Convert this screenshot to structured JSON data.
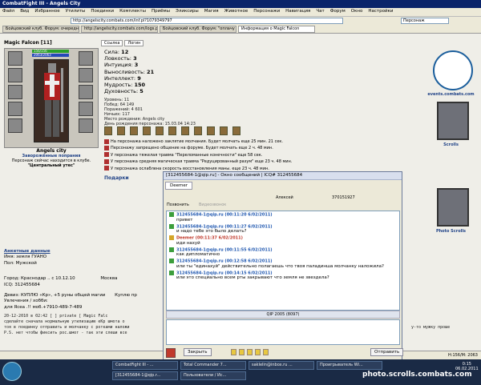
{
  "browser": {
    "title": "CombatFight III - Angels City",
    "menu": [
      "Файл",
      "Вид",
      "Избранное",
      "Утилиты",
      "Поединки",
      "Комплекты",
      "Приёмы",
      "Эликсиры",
      "Магия",
      "Животное",
      "Персонажи",
      "Навигация",
      "Чат",
      "Форум",
      "Окно",
      "Настройки"
    ],
    "address": "http://angelscity.combats.com/inf.pl?1079349797",
    "search_placeholder": "Персонаж",
    "tabs": [
      "Бойцовский клуб. Форум: очередно...",
      "http://angelscity.combats.com/logs.pl...",
      "Бойцовский клуб. Форум: \"оплачу м...",
      "Информация о Magic Falcon"
    ],
    "status": "H:156/M: 2063"
  },
  "character": {
    "name": "Magic Falcon [11]",
    "hp": "156/156",
    "mp": "2063/2063",
    "city": "Angels city",
    "clan": "Заворожённые попрания",
    "location_line1": "Персонаж сейчас находится в клубе.",
    "location_line2": "\"Центральный утес\"",
    "buttons": {
      "links": "Ссылка",
      "login": "Логин"
    },
    "stats": {
      "strength": {
        "label": "Сила:",
        "value": "12"
      },
      "agility": {
        "label": "Ловкость:",
        "value": "3"
      },
      "intuition": {
        "label": "Интуиция:",
        "value": "3"
      },
      "endurance": {
        "label": "Выносливость:",
        "value": "21"
      },
      "intellect": {
        "label": "Интеллект:",
        "value": "9"
      },
      "wisdom": {
        "label": "Мудрость:",
        "value": "150"
      },
      "spirit": {
        "label": "Духовность:",
        "value": "5"
      }
    },
    "small": [
      "Уровень: 11",
      "Побед: 64 149",
      "Поражений: 4 601",
      "Ничьих: 117",
      "Место рождения: Angels city",
      "День рождения персонажа: 15.03.04 14:23"
    ],
    "effects": [
      "На персонажа наложено заклятие молчания. Будет молчать еще 25 мин. 21 сек.",
      "Персонажу запрещено общение на форуме. Будет молчать еще 2 ч. 48 мин.",
      "У персонажа тяжелая травма \"Переломанные конечности\" еще 58 сек.",
      "У персонажа средняя магическая травма \"Редуцированный разум\" еще 23 ч. 48 мин.",
      "У персонажа ослаблена скорость восстановления маны. еще 23 ч. 48 мин."
    ],
    "gifts": "Подарки"
  },
  "right": {
    "site": "events.combats.com",
    "scrolls": "Scrolls",
    "photo": "Photo Scrolls"
  },
  "profile": {
    "header": "Анкетные данные",
    "name": "Имя: земля ГУАНО",
    "sex": "Пол: Мужской",
    "city": "Город: Краснодар .. с 10.12.10",
    "city2": "Москва",
    "icq": "ICQ: 312455684",
    "motto": "Девиз: КУПЛЮ «Кр», +5 руны общей магии",
    "motto2": "Куплю пр",
    "hobby_lbl": "Увлечения / хобби:",
    "hobby": "для Ясеа .!! моб.+7910-489-7-489"
  },
  "diary": [
    "20-12-2010 в 02:42  [      ] private [ Magic Falc",
    "сделайте сначала нормальную утилизацию еКр шмота о",
    "тоя в поединку отправить и молчанку с ротками наложи",
    "P.S. нет чтобы фиксить рос.шмот - так эти слеши все"
  ],
  "diary_right": "у-то мужку проше",
  "qip": {
    "title": "[312455684-1@qip.ru] - Окно сообщений | ICQ# 312455684",
    "contact_tab": "Deemer",
    "call": "Позвонить",
    "video": "Видеозвонок",
    "nick": "Алексей",
    "uin": "370151927",
    "version": "QIP 2005 (8097)",
    "close": "Закрыть",
    "send": "Отправить",
    "messages": [
      {
        "from": "312455684-1@qip.ru (00:11:20 6/02/2011)",
        "text": "привет",
        "own": false
      },
      {
        "from": "312455684-1@qip.ru (00:11:27 6/02/2011)",
        "text": "и надо тебе это было делать?",
        "own": false
      },
      {
        "from": "Deemer (00:11:37 6/02/2011)",
        "text": "иди нахуй",
        "own": true
      },
      {
        "from": "312455684-1@qip.ru (00:11:55 6/02/2011)",
        "text": "как дипломатично",
        "own": false
      },
      {
        "from": "312455684-1@qip.ru (00:12:58 6/02/2011)",
        "text": "или ты \"единахуй\" действительно полагаешь что твоя паладинша молчанку наложила?",
        "own": false
      },
      {
        "from": "312455684-1@qip.ru (00:14:15 6/02/2011)",
        "text": "или это специально всем рты закрывают что земля не звездела?",
        "own": false
      }
    ]
  },
  "taskbar": {
    "tasks": [
      "CombatFight III - ...",
      "Total Commander 7...",
      "saklelin@inbox.ru ...",
      "Проигрыватель Wi...",
      "[312455684-1@qip.r...",
      "Пользователи / Ис..."
    ],
    "clock": "0:15",
    "date": "06.02.2011",
    "watermark": "photo.scrolls.combats.com"
  }
}
